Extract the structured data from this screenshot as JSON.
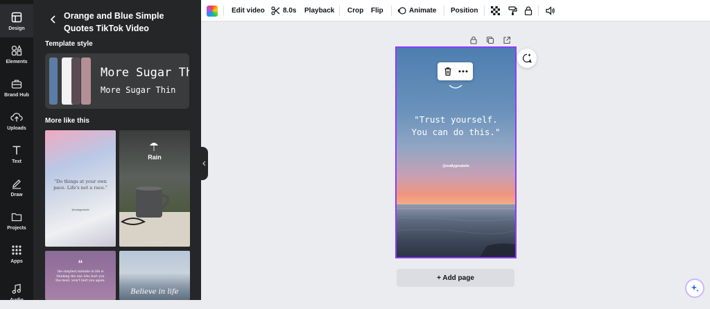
{
  "rail": {
    "items": [
      {
        "label": "Design",
        "icon": "layout-icon"
      },
      {
        "label": "Elements",
        "icon": "shapes-icon"
      },
      {
        "label": "Brand Hub",
        "icon": "briefcase-icon"
      },
      {
        "label": "Uploads",
        "icon": "cloud-upload-icon"
      },
      {
        "label": "Text",
        "icon": "text-icon"
      },
      {
        "label": "Draw",
        "icon": "pen-icon"
      },
      {
        "label": "Projects",
        "icon": "folder-icon"
      },
      {
        "label": "Apps",
        "icon": "grid-icon"
      },
      {
        "label": "Audio",
        "icon": "music-icon"
      }
    ]
  },
  "panel": {
    "title": "Orange and Blue Simple Quotes TikTok Video",
    "template_style_heading": "Template style",
    "font_preview_1": "More Sugar Th",
    "font_preview_2": "More Sugar Thin",
    "swatches": [
      "#5b7ca6",
      "#f2f2f2",
      "#5a4b52",
      "#b58f96"
    ],
    "more_like_this_heading": "More like this",
    "thumbs": {
      "t1_quote": "\"Do things at your own pace. Life's not a race.\"",
      "t1_handle": "@reallygreatsite",
      "t2_title": "Rain",
      "t2_handle": "@reallygreatsite",
      "t3_quote_mark": "“",
      "t3_text": "the simplest mistake in life is thinking the one who hurt you the most, won't hurt you again.",
      "t4_text": "Believe in life"
    }
  },
  "toolbar": {
    "edit_video": "Edit video",
    "duration": "8.0s",
    "playback": "Playback",
    "crop": "Crop",
    "flip": "Flip",
    "animate": "Animate",
    "position": "Position"
  },
  "canvas": {
    "quote_line1": "\"Trust yourself.",
    "quote_line2": "You can do this.\"",
    "handle": "@reallygreatsite",
    "add_page": "+ Add page"
  },
  "colors": {
    "accent": "#8b3dff",
    "sidebar_bg": "#252627",
    "rail_bg": "#18191b",
    "canvas_bg": "#ebecf0"
  }
}
